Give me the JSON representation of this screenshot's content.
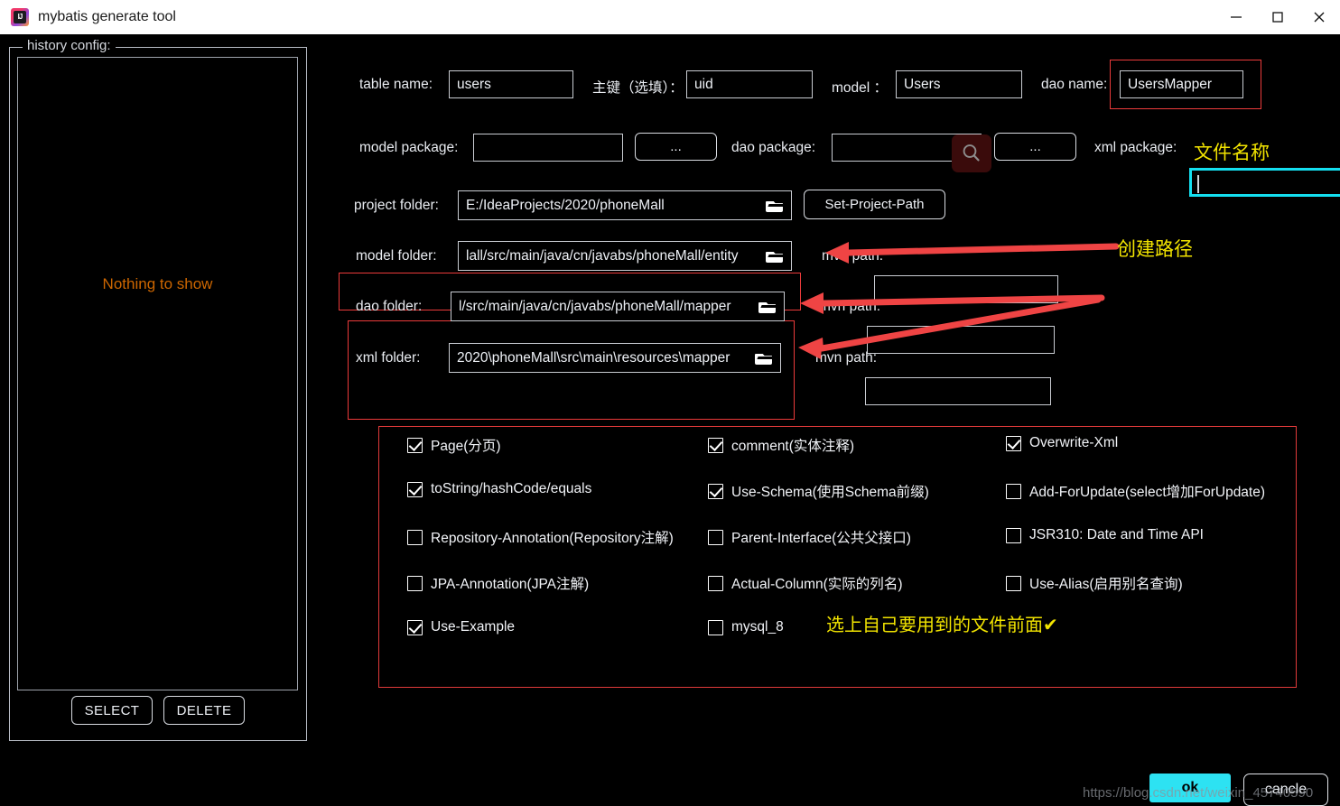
{
  "window": {
    "title": "mybatis generate tool",
    "icon": "intellij-idea-icon",
    "controls": {
      "minimize": "—",
      "maximize": "☐",
      "close": "✕"
    }
  },
  "history": {
    "legend": "history config:",
    "empty_text": "Nothing to show",
    "select_label": "SELECT",
    "delete_label": "DELETE"
  },
  "form": {
    "table_name": {
      "label": "table  name:",
      "value": "users"
    },
    "primary_key": {
      "label": "主键（选填）：",
      "value": "uid"
    },
    "model": {
      "label": "model  ：",
      "value": "Users"
    },
    "dao_name": {
      "label": "dao name:",
      "value": "UsersMapper"
    },
    "model_package": {
      "label": "model package:",
      "value": "",
      "browse": "..."
    },
    "dao_package": {
      "label": "dao package:",
      "value": "",
      "browse": "..."
    },
    "xml_package": {
      "label": "xml package:",
      "value": ""
    },
    "project_folder": {
      "label": "project folder:",
      "value": "E:/IdeaProjects/2020/phoneMall",
      "button": "Set-Project-Path"
    },
    "model_folder": {
      "label": "model  folder:",
      "value": "lall/src/main/java/cn/javabs/phoneMall/entity",
      "mvn_label": "mvn path:",
      "mvn_value": ""
    },
    "dao_folder": {
      "label": "dao     folder:",
      "value": "l/src/main/java/cn/javabs/phoneMall/mapper",
      "mvn_label": "mvn path:",
      "mvn_value": ""
    },
    "xml_folder": {
      "label": "xml     folder:",
      "value": "2020\\phoneMall\\src\\main\\resources\\mapper",
      "mvn_label": "mvn path:",
      "mvn_value": ""
    }
  },
  "options": [
    {
      "label": "Page(分页)",
      "checked": true,
      "col": 0,
      "row": 0
    },
    {
      "label": "toString/hashCode/equals",
      "checked": true,
      "col": 0,
      "row": 1
    },
    {
      "label": "Repository-Annotation(Repository注解)",
      "checked": false,
      "col": 0,
      "row": 2
    },
    {
      "label": "JPA-Annotation(JPA注解)",
      "checked": false,
      "col": 0,
      "row": 3
    },
    {
      "label": "Use-Example",
      "checked": true,
      "col": 0,
      "row": 4
    },
    {
      "label": "comment(实体注释)",
      "checked": true,
      "col": 1,
      "row": 0
    },
    {
      "label": "Use-Schema(使用Schema前缀)",
      "checked": true,
      "col": 1,
      "row": 1
    },
    {
      "label": "Parent-Interface(公共父接口)",
      "checked": false,
      "col": 1,
      "row": 2
    },
    {
      "label": "Actual-Column(实际的列名)",
      "checked": false,
      "col": 1,
      "row": 3
    },
    {
      "label": "mysql_8",
      "checked": false,
      "col": 1,
      "row": 4
    },
    {
      "label": "Overwrite-Xml",
      "checked": true,
      "col": 2,
      "row": 0
    },
    {
      "label": "Add-ForUpdate(select增加ForUpdate)",
      "checked": false,
      "col": 2,
      "row": 1
    },
    {
      "label": "JSR310: Date and Time API",
      "checked": false,
      "col": 2,
      "row": 2
    },
    {
      "label": "Use-Alias(启用别名查询)",
      "checked": false,
      "col": 2,
      "row": 3
    }
  ],
  "annotations": {
    "file_name_note": "文件名称",
    "create_path_note": "创建路径",
    "select_note": "选上自己要用到的文件前面✔",
    "highlight_color": "#ec3b3b",
    "note_color": "#f2e400",
    "focus_color": "#14dff0"
  },
  "footer": {
    "ok_label": "ok",
    "cancel_label": "cancle",
    "watermark": "https://blog.csdn.net/weixin_45740590"
  }
}
